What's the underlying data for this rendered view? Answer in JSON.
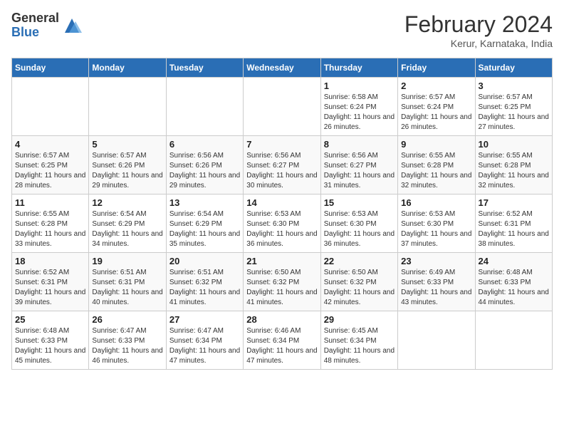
{
  "header": {
    "logo_general": "General",
    "logo_blue": "Blue",
    "month_title": "February 2024",
    "location": "Kerur, Karnataka, India"
  },
  "weekdays": [
    "Sunday",
    "Monday",
    "Tuesday",
    "Wednesday",
    "Thursday",
    "Friday",
    "Saturday"
  ],
  "weeks": [
    [
      {
        "day": "",
        "info": ""
      },
      {
        "day": "",
        "info": ""
      },
      {
        "day": "",
        "info": ""
      },
      {
        "day": "",
        "info": ""
      },
      {
        "day": "1",
        "info": "Sunrise: 6:58 AM\nSunset: 6:24 PM\nDaylight: 11 hours and 26 minutes."
      },
      {
        "day": "2",
        "info": "Sunrise: 6:57 AM\nSunset: 6:24 PM\nDaylight: 11 hours and 26 minutes."
      },
      {
        "day": "3",
        "info": "Sunrise: 6:57 AM\nSunset: 6:25 PM\nDaylight: 11 hours and 27 minutes."
      }
    ],
    [
      {
        "day": "4",
        "info": "Sunrise: 6:57 AM\nSunset: 6:25 PM\nDaylight: 11 hours and 28 minutes."
      },
      {
        "day": "5",
        "info": "Sunrise: 6:57 AM\nSunset: 6:26 PM\nDaylight: 11 hours and 29 minutes."
      },
      {
        "day": "6",
        "info": "Sunrise: 6:56 AM\nSunset: 6:26 PM\nDaylight: 11 hours and 29 minutes."
      },
      {
        "day": "7",
        "info": "Sunrise: 6:56 AM\nSunset: 6:27 PM\nDaylight: 11 hours and 30 minutes."
      },
      {
        "day": "8",
        "info": "Sunrise: 6:56 AM\nSunset: 6:27 PM\nDaylight: 11 hours and 31 minutes."
      },
      {
        "day": "9",
        "info": "Sunrise: 6:55 AM\nSunset: 6:28 PM\nDaylight: 11 hours and 32 minutes."
      },
      {
        "day": "10",
        "info": "Sunrise: 6:55 AM\nSunset: 6:28 PM\nDaylight: 11 hours and 32 minutes."
      }
    ],
    [
      {
        "day": "11",
        "info": "Sunrise: 6:55 AM\nSunset: 6:28 PM\nDaylight: 11 hours and 33 minutes."
      },
      {
        "day": "12",
        "info": "Sunrise: 6:54 AM\nSunset: 6:29 PM\nDaylight: 11 hours and 34 minutes."
      },
      {
        "day": "13",
        "info": "Sunrise: 6:54 AM\nSunset: 6:29 PM\nDaylight: 11 hours and 35 minutes."
      },
      {
        "day": "14",
        "info": "Sunrise: 6:53 AM\nSunset: 6:30 PM\nDaylight: 11 hours and 36 minutes."
      },
      {
        "day": "15",
        "info": "Sunrise: 6:53 AM\nSunset: 6:30 PM\nDaylight: 11 hours and 36 minutes."
      },
      {
        "day": "16",
        "info": "Sunrise: 6:53 AM\nSunset: 6:30 PM\nDaylight: 11 hours and 37 minutes."
      },
      {
        "day": "17",
        "info": "Sunrise: 6:52 AM\nSunset: 6:31 PM\nDaylight: 11 hours and 38 minutes."
      }
    ],
    [
      {
        "day": "18",
        "info": "Sunrise: 6:52 AM\nSunset: 6:31 PM\nDaylight: 11 hours and 39 minutes."
      },
      {
        "day": "19",
        "info": "Sunrise: 6:51 AM\nSunset: 6:31 PM\nDaylight: 11 hours and 40 minutes."
      },
      {
        "day": "20",
        "info": "Sunrise: 6:51 AM\nSunset: 6:32 PM\nDaylight: 11 hours and 41 minutes."
      },
      {
        "day": "21",
        "info": "Sunrise: 6:50 AM\nSunset: 6:32 PM\nDaylight: 11 hours and 41 minutes."
      },
      {
        "day": "22",
        "info": "Sunrise: 6:50 AM\nSunset: 6:32 PM\nDaylight: 11 hours and 42 minutes."
      },
      {
        "day": "23",
        "info": "Sunrise: 6:49 AM\nSunset: 6:33 PM\nDaylight: 11 hours and 43 minutes."
      },
      {
        "day": "24",
        "info": "Sunrise: 6:48 AM\nSunset: 6:33 PM\nDaylight: 11 hours and 44 minutes."
      }
    ],
    [
      {
        "day": "25",
        "info": "Sunrise: 6:48 AM\nSunset: 6:33 PM\nDaylight: 11 hours and 45 minutes."
      },
      {
        "day": "26",
        "info": "Sunrise: 6:47 AM\nSunset: 6:33 PM\nDaylight: 11 hours and 46 minutes."
      },
      {
        "day": "27",
        "info": "Sunrise: 6:47 AM\nSunset: 6:34 PM\nDaylight: 11 hours and 47 minutes."
      },
      {
        "day": "28",
        "info": "Sunrise: 6:46 AM\nSunset: 6:34 PM\nDaylight: 11 hours and 47 minutes."
      },
      {
        "day": "29",
        "info": "Sunrise: 6:45 AM\nSunset: 6:34 PM\nDaylight: 11 hours and 48 minutes."
      },
      {
        "day": "",
        "info": ""
      },
      {
        "day": "",
        "info": ""
      }
    ]
  ]
}
